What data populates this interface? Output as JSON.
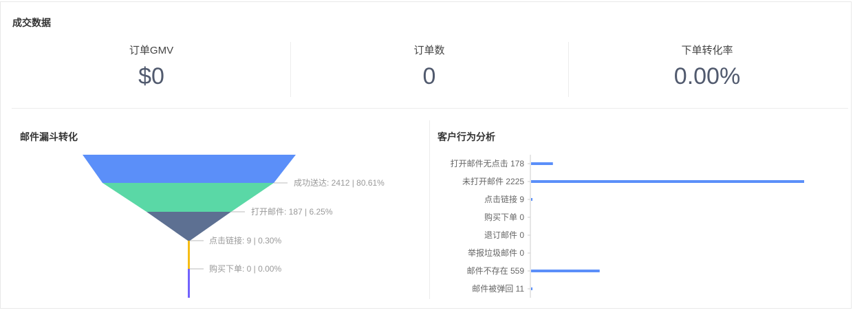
{
  "section": {
    "title": "成交数据"
  },
  "stats": [
    {
      "label": "订单GMV",
      "value": "$0"
    },
    {
      "label": "订单数",
      "value": "0"
    },
    {
      "label": "下单转化率",
      "value": "0.00%"
    }
  ],
  "funnel": {
    "title": "邮件漏斗转化",
    "stages": [
      {
        "label": "成功送达: 2412 | 80.61%",
        "color": "#5b8ff9"
      },
      {
        "label": "打开邮件: 187 | 6.25%",
        "color": "#5ad8a6"
      },
      {
        "label": "点击链接: 9 | 0.30%",
        "color": "#5d7092"
      },
      {
        "label": "购买下单: 0 | 0.00%",
        "color": "#f6bd16"
      },
      {
        "color": "#7262fd"
      }
    ]
  },
  "behavior": {
    "title": "客户行为分析",
    "bar_color": "#5b8ff9"
  },
  "chart_data": {
    "type": "bar",
    "orientation": "horizontal",
    "categories": [
      "打开邮件无点击 178",
      "未打开邮件 2225",
      "点击链接 9",
      "购买下单 0",
      "退订邮件 0",
      "举报垃圾邮件 0",
      "邮件不存在 559",
      "邮件被弹回 11"
    ],
    "values": [
      178,
      2225,
      9,
      0,
      0,
      0,
      559,
      11
    ],
    "title": "客户行为分析",
    "xlabel": "",
    "ylabel": "",
    "xlim": [
      0,
      2225
    ],
    "grid": false,
    "legend": "none"
  }
}
